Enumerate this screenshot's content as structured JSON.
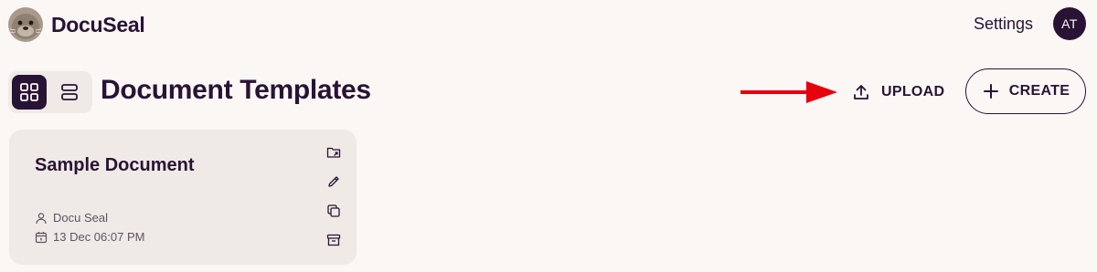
{
  "app": {
    "name": "DocuSeal"
  },
  "header": {
    "settings_label": "Settings",
    "avatar_initials": "AT"
  },
  "toolbar": {
    "title": "Document Templates",
    "upload_label": "UPLOAD",
    "create_label": "CREATE",
    "view_modes": [
      {
        "icon": "grid-view-icon",
        "active": true
      },
      {
        "icon": "list-view-icon",
        "active": false
      }
    ]
  },
  "templates": [
    {
      "title": "Sample Document",
      "author": "Docu Seal",
      "date": "13 Dec 06:07 PM",
      "actions": [
        "move-to-folder-icon",
        "edit-icon",
        "copy-icon",
        "archive-icon"
      ]
    }
  ],
  "colors": {
    "primary": "#291334",
    "background": "#faf7f5",
    "card": "#efeae6",
    "annotation_arrow": "#e8000d"
  }
}
